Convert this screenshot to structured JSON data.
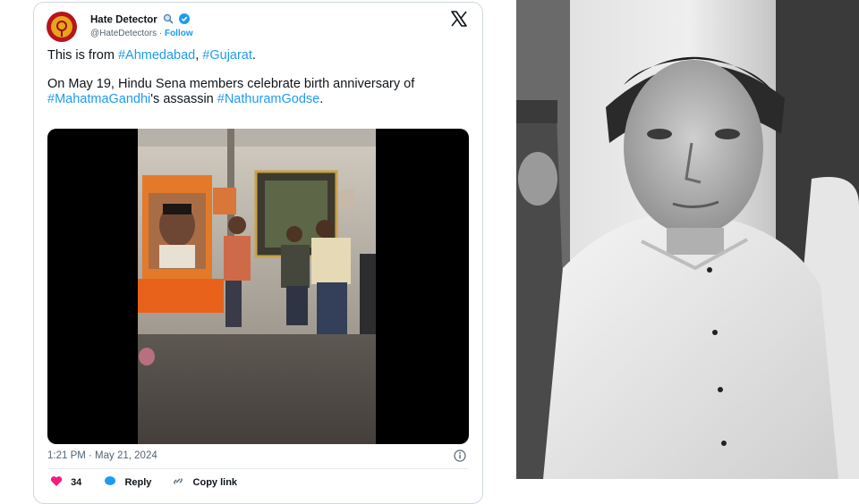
{
  "tweet": {
    "author_name": "Hate Detector",
    "handle": "@HateDetectors",
    "separator": " · ",
    "follow_label": "Follow",
    "line1_prefix": "This is from ",
    "line1_tag1": "#Ahmedabad",
    "line1_sep": ", ",
    "line1_tag2": "#Gujarat",
    "line1_suffix": ".",
    "line2_prefix": "On May 19, Hindu Sena members celebrate birth anniversary of ",
    "line2_tag1": "#MahatmaGandhi",
    "line2_mid": "'s assassin",
    "line2_tag2": "#NathuramGodse",
    "line2_suffix": ".",
    "timestamp": "1:21 PM · May 21, 2024",
    "like_count": "34",
    "reply_label": "Reply",
    "copy_label": "Copy link"
  },
  "icons": {
    "search": "magnifier-icon",
    "verified": "verified-badge-icon",
    "x_logo": "x-logo-icon",
    "info": "info-icon",
    "like": "heart-icon",
    "reply": "reply-bubble-icon",
    "copy": "link-icon"
  },
  "colors": {
    "accent": "#1d9bf0",
    "text": "#0f1419",
    "muted": "#536471",
    "like": "#f91880"
  }
}
